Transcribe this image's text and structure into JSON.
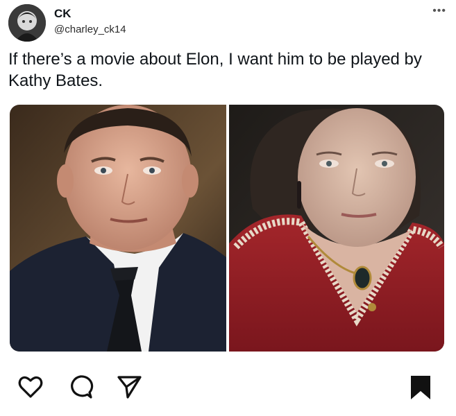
{
  "author": {
    "name": "CK",
    "handle": "@charley_ck14"
  },
  "tweet": {
    "text": "If there’s a movie about Elon, I want him to be played by Kathy Bates."
  },
  "media": {
    "left_photo": "man-in-dark-suit-portrait",
    "right_photo": "woman-in-red-dress-portrait"
  },
  "icons": {
    "more": "more-icon",
    "like": "heart-icon",
    "comment": "comment-bubble-icon",
    "share": "send-icon",
    "save": "bookmark-icon"
  },
  "colors": {
    "text": "#0f1419",
    "dress_red": "#8f1d24",
    "suit": "#1c2232"
  }
}
